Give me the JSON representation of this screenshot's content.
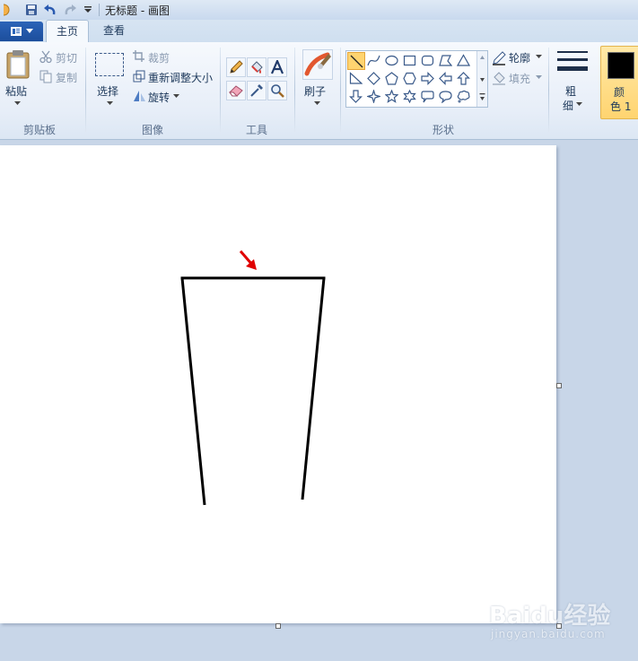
{
  "window": {
    "title": "无标题 - 画图"
  },
  "tabs": [
    {
      "label": "主页",
      "active": true
    },
    {
      "label": "查看",
      "active": false
    }
  ],
  "ribbon": {
    "clipboard": {
      "paste_label": "粘贴",
      "cut_label": "剪切",
      "copy_label": "复制",
      "group_label": "剪贴板"
    },
    "image": {
      "select_label": "选择",
      "crop_label": "裁剪",
      "resize_label": "重新调整大小",
      "rotate_label": "旋转",
      "group_label": "图像"
    },
    "tools": {
      "group_label": "工具",
      "icons": [
        "pencil-icon",
        "fill-bucket-icon",
        "text-icon",
        "eraser-icon",
        "color-picker-icon",
        "magnifier-icon"
      ]
    },
    "brushes": {
      "label": "刷子"
    },
    "shapes": {
      "outline_label": "轮廓",
      "fill_label": "填充",
      "group_label": "形状",
      "selected": "line"
    },
    "size": {
      "label_line1": "粗",
      "label_line2": "细"
    },
    "color1": {
      "label_line1": "颜",
      "label_line2": "色 1",
      "color": "#000000"
    }
  },
  "canvas": {
    "background": "#ffffff",
    "stroke_color": "#000000",
    "arrow_color": "#e00000"
  },
  "watermark": {
    "brand": "Baidu经验",
    "url": "jingyan.baidu.com"
  },
  "colors": {
    "ribbon_bg": "#e7eef8",
    "workspace_bg": "#c8d6e8",
    "accent": "#2b64b8",
    "selected_highlight": "#ffd470"
  }
}
